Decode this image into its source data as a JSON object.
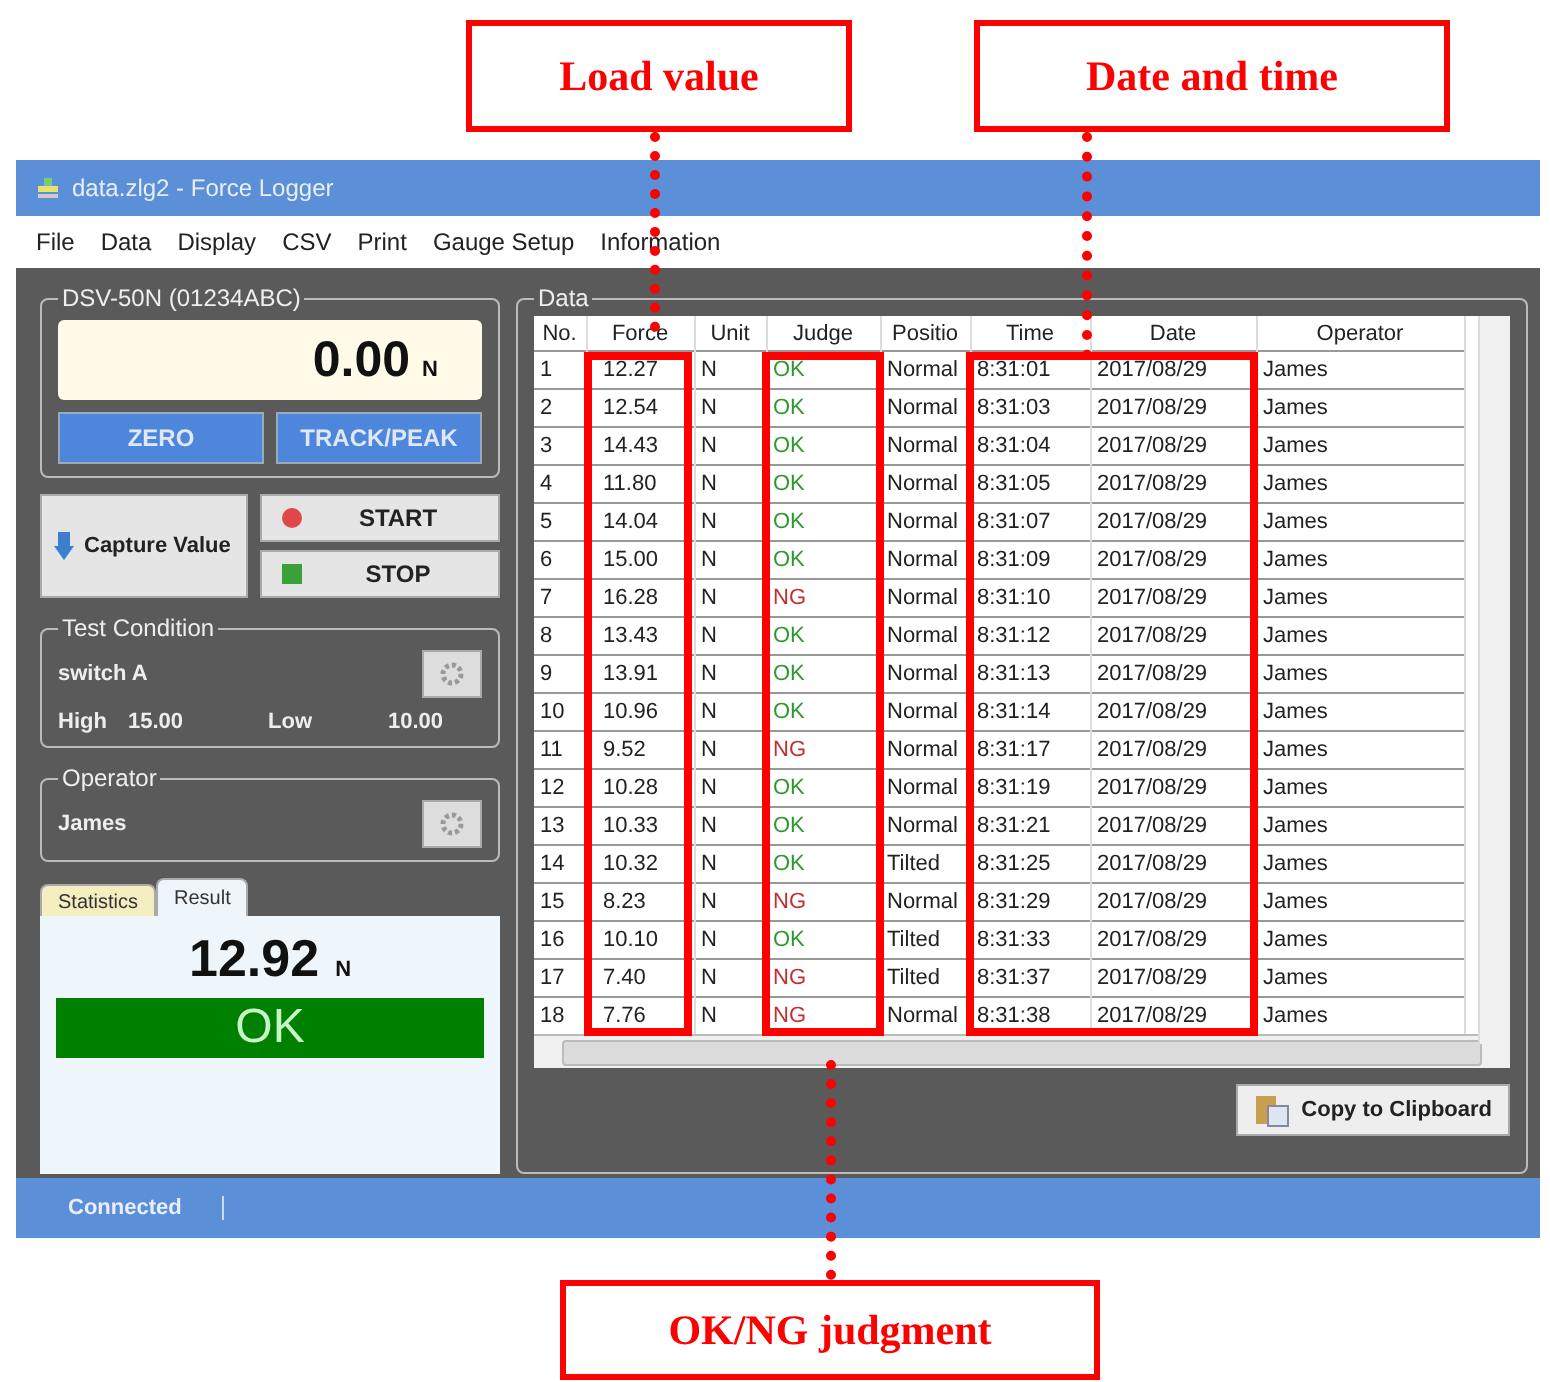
{
  "callouts": [
    {
      "text": "Load value",
      "kind": "force"
    },
    {
      "text": "Date and time",
      "kind": "datetime"
    },
    {
      "text": "OK/NG judgment",
      "kind": "judge"
    }
  ],
  "window": {
    "title": "data.zlg2 - Force Logger"
  },
  "menu": [
    "File",
    "Data",
    "Display",
    "CSV",
    "Print",
    "Gauge Setup",
    "Information"
  ],
  "device": {
    "title": "DSV-50N (01234ABC)",
    "reading": "0.00",
    "unit": "N",
    "buttons": [
      "ZERO",
      "TRACK/PEAK"
    ]
  },
  "capture": {
    "label": "Capture Value"
  },
  "start": {
    "label": "START"
  },
  "stop": {
    "label": "STOP"
  },
  "test_condition": {
    "title": "Test Condition",
    "name": "switch A",
    "high_label": "High",
    "high": "15.00",
    "low_label": "Low",
    "low": "10.00"
  },
  "operator": {
    "title": "Operator",
    "name": "James"
  },
  "tabs": [
    {
      "label": "Statistics",
      "selected": false
    },
    {
      "label": "Result",
      "selected": true
    }
  ],
  "result": {
    "value": "12.92",
    "unit": "N",
    "judgment": "OK",
    "color": "#008000"
  },
  "data": {
    "title": "Data",
    "columns": [
      "No.",
      "Force",
      "Unit",
      "Judge",
      "Positio",
      "Time",
      "Date",
      "Operator"
    ],
    "rows": [
      {
        "no": "1",
        "force": "12.27",
        "unit": "N",
        "judge": "OK",
        "color": "#2e9a2e",
        "position": "Normal",
        "time": "8:31:01",
        "date": "2017/08/29",
        "operator": "James"
      },
      {
        "no": "2",
        "force": "12.54",
        "unit": "N",
        "judge": "OK",
        "color": "#2e9a2e",
        "position": "Normal",
        "time": "8:31:03",
        "date": "2017/08/29",
        "operator": "James"
      },
      {
        "no": "3",
        "force": "14.43",
        "unit": "N",
        "judge": "OK",
        "color": "#2e9a2e",
        "position": "Normal",
        "time": "8:31:04",
        "date": "2017/08/29",
        "operator": "James"
      },
      {
        "no": "4",
        "force": "11.80",
        "unit": "N",
        "judge": "OK",
        "color": "#2e9a2e",
        "position": "Normal",
        "time": "8:31:05",
        "date": "2017/08/29",
        "operator": "James"
      },
      {
        "no": "5",
        "force": "14.04",
        "unit": "N",
        "judge": "OK",
        "color": "#2e9a2e",
        "position": "Normal",
        "time": "8:31:07",
        "date": "2017/08/29",
        "operator": "James"
      },
      {
        "no": "6",
        "force": "15.00",
        "unit": "N",
        "judge": "OK",
        "color": "#2e9a2e",
        "position": "Normal",
        "time": "8:31:09",
        "date": "2017/08/29",
        "operator": "James"
      },
      {
        "no": "7",
        "force": "16.28",
        "unit": "N",
        "judge": "NG",
        "color": "#c03030",
        "position": "Normal",
        "time": "8:31:10",
        "date": "2017/08/29",
        "operator": "James"
      },
      {
        "no": "8",
        "force": "13.43",
        "unit": "N",
        "judge": "OK",
        "color": "#2e9a2e",
        "position": "Normal",
        "time": "8:31:12",
        "date": "2017/08/29",
        "operator": "James"
      },
      {
        "no": "9",
        "force": "13.91",
        "unit": "N",
        "judge": "OK",
        "color": "#2e9a2e",
        "position": "Normal",
        "time": "8:31:13",
        "date": "2017/08/29",
        "operator": "James"
      },
      {
        "no": "10",
        "force": "10.96",
        "unit": "N",
        "judge": "OK",
        "color": "#2e9a2e",
        "position": "Normal",
        "time": "8:31:14",
        "date": "2017/08/29",
        "operator": "James"
      },
      {
        "no": "11",
        "force": "9.52",
        "unit": "N",
        "judge": "NG",
        "color": "#c03030",
        "position": "Normal",
        "time": "8:31:17",
        "date": "2017/08/29",
        "operator": "James"
      },
      {
        "no": "12",
        "force": "10.28",
        "unit": "N",
        "judge": "OK",
        "color": "#2e9a2e",
        "position": "Normal",
        "time": "8:31:19",
        "date": "2017/08/29",
        "operator": "James"
      },
      {
        "no": "13",
        "force": "10.33",
        "unit": "N",
        "judge": "OK",
        "color": "#2e9a2e",
        "position": "Normal",
        "time": "8:31:21",
        "date": "2017/08/29",
        "operator": "James"
      },
      {
        "no": "14",
        "force": "10.32",
        "unit": "N",
        "judge": "OK",
        "color": "#2e9a2e",
        "position": "Tilted",
        "time": "8:31:25",
        "date": "2017/08/29",
        "operator": "James"
      },
      {
        "no": "15",
        "force": "8.23",
        "unit": "N",
        "judge": "NG",
        "color": "#c03030",
        "position": "Normal",
        "time": "8:31:29",
        "date": "2017/08/29",
        "operator": "James"
      },
      {
        "no": "16",
        "force": "10.10",
        "unit": "N",
        "judge": "OK",
        "color": "#2e9a2e",
        "position": "Tilted",
        "time": "8:31:33",
        "date": "2017/08/29",
        "operator": "James"
      },
      {
        "no": "17",
        "force": "7.40",
        "unit": "N",
        "judge": "NG",
        "color": "#c03030",
        "position": "Tilted",
        "time": "8:31:37",
        "date": "2017/08/29",
        "operator": "James"
      },
      {
        "no": "18",
        "force": "7.76",
        "unit": "N",
        "judge": "NG",
        "color": "#c03030",
        "position": "Normal",
        "time": "8:31:38",
        "date": "2017/08/29",
        "operator": "James"
      }
    ]
  },
  "copy_button": {
    "label": "Copy to Clipboard"
  },
  "status_bar": {
    "text": "Connected"
  }
}
